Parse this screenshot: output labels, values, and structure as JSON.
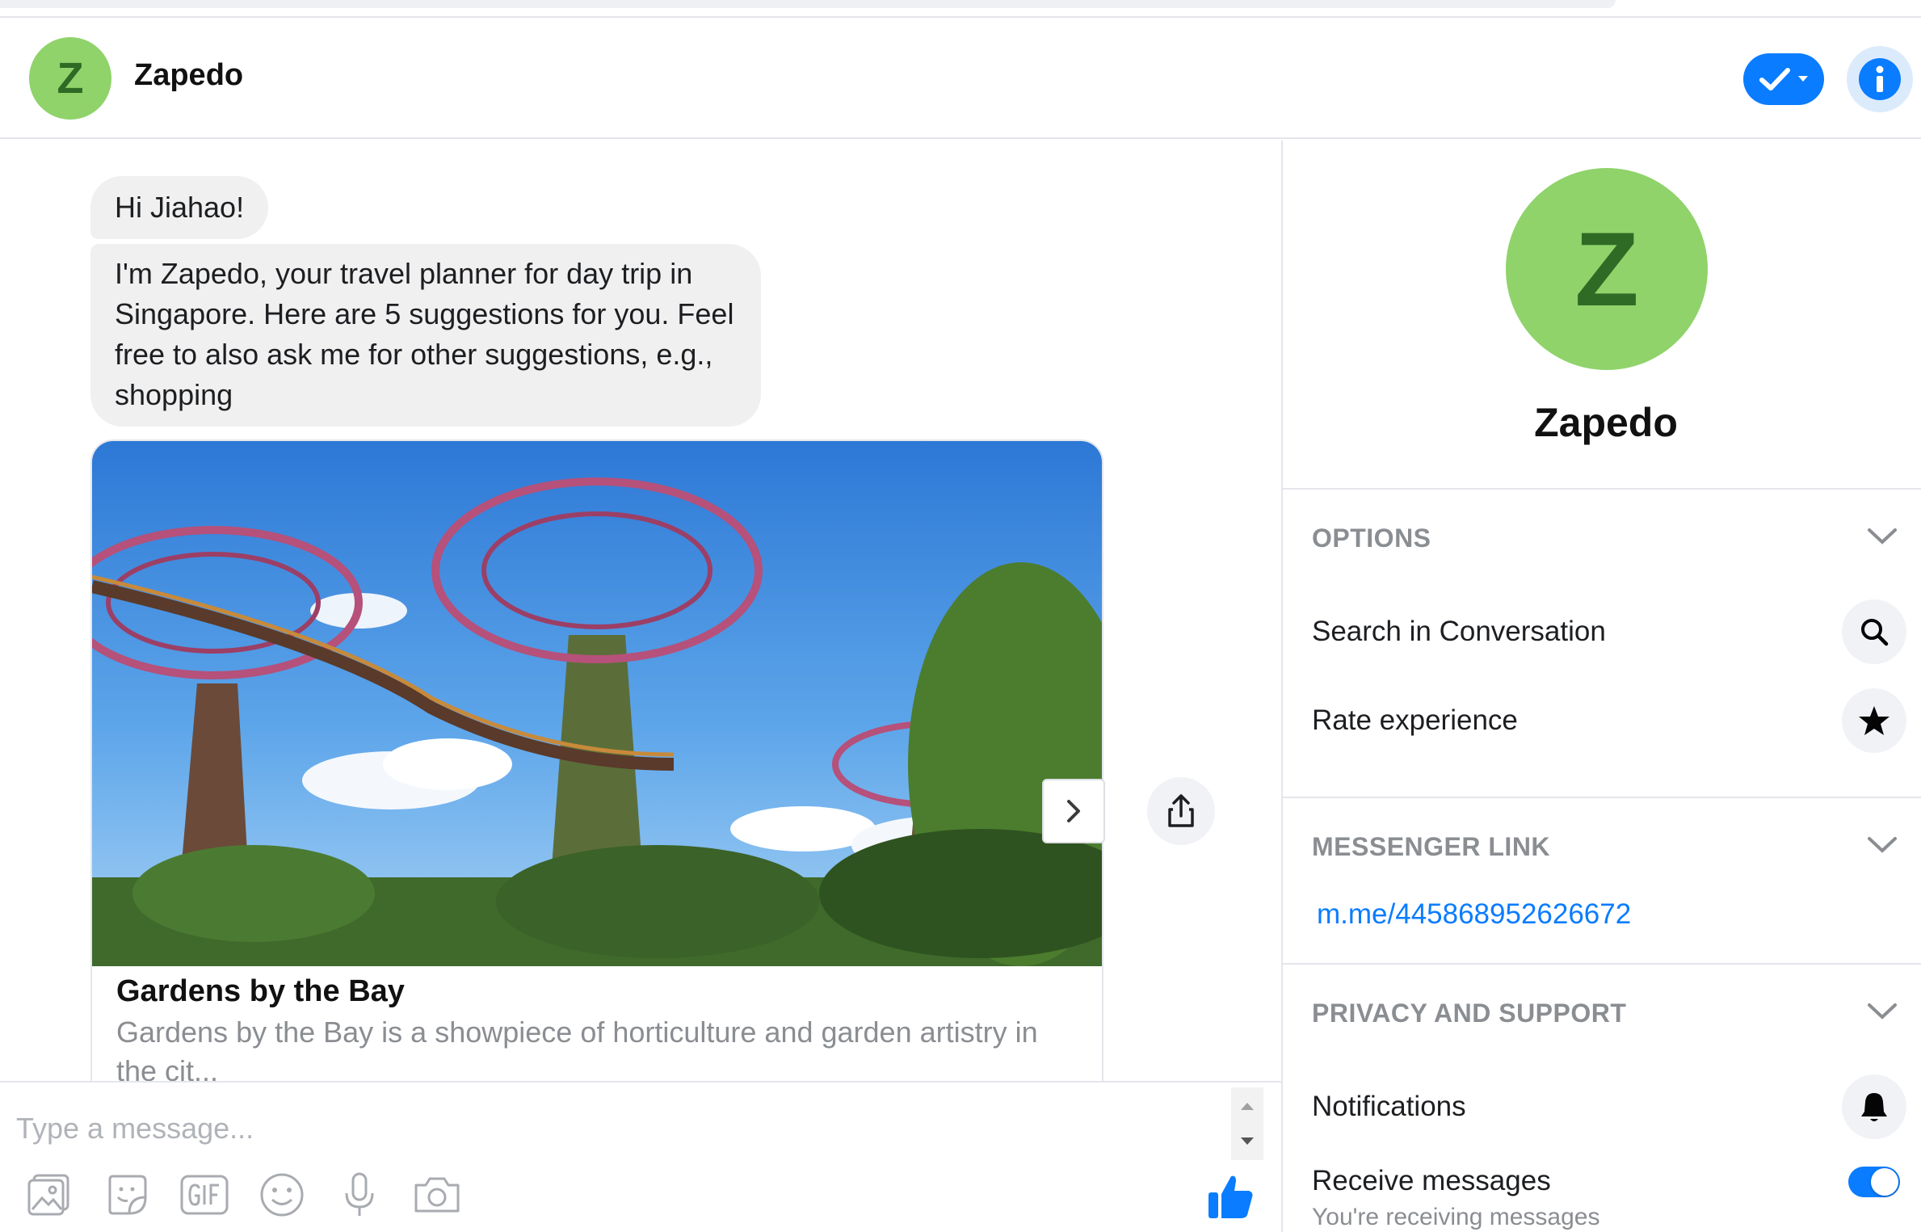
{
  "header": {
    "avatar_letter": "Z",
    "title": "Zapedo"
  },
  "conversation": {
    "messages": [
      "Hi Jiahao!",
      "I'm Zapedo, your travel planner for day trip in Singapore. Here are 5 suggestions for you. Feel free to also ask me for other suggestions, e.g., shopping"
    ],
    "card": {
      "title": "Gardens by the Bay",
      "subtitle": "Gardens by the Bay is a showpiece of horticulture and garden artistry in the cit..."
    }
  },
  "composer": {
    "placeholder": "Type a message..."
  },
  "sidebar": {
    "avatar_letter": "Z",
    "name": "Zapedo",
    "options": {
      "title": "OPTIONS",
      "items": [
        "Search in Conversation",
        "Rate experience"
      ]
    },
    "messenger_link": {
      "title": "MESSENGER LINK",
      "url": "m.me/445868952626672"
    },
    "privacy": {
      "title": "PRIVACY AND SUPPORT",
      "notifications": "Notifications",
      "receive_messages": "Receive messages",
      "receive_note": "You're receiving messages",
      "receive_enabled": true
    }
  },
  "colors": {
    "accent": "#0a7cff",
    "avatar_bg": "#8fd36a",
    "avatar_fg": "#2f6b25",
    "bubble_bg": "#f0f0f0"
  }
}
